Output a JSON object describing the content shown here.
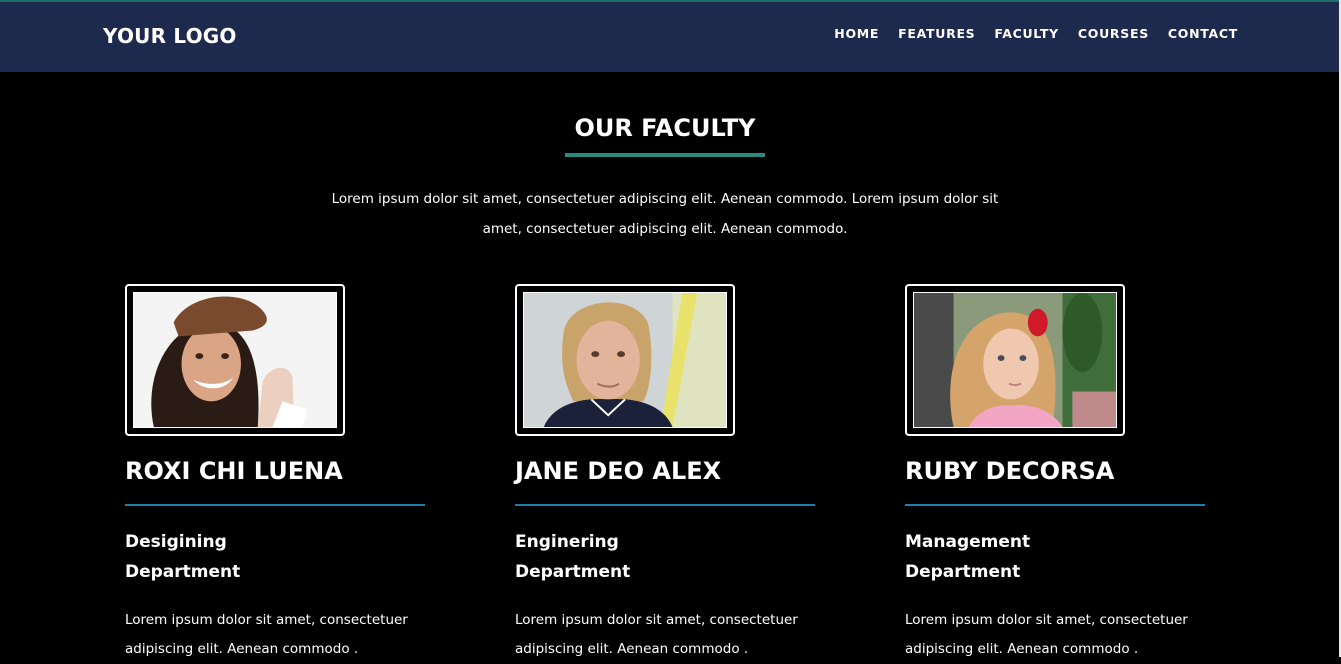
{
  "header": {
    "logo": "YOUR LOGO",
    "nav": [
      {
        "label": "HOME"
      },
      {
        "label": "FEATURES"
      },
      {
        "label": "FACULTY"
      },
      {
        "label": "COURSES"
      },
      {
        "label": "CONTACT"
      }
    ]
  },
  "section": {
    "title": "OUR FACULTY",
    "intro": "Lorem ipsum dolor sit amet, consectetuer adipiscing elit. Aenean commodo. Lorem ipsum dolor sit amet, consectetuer adipiscing elit. Aenean commodo."
  },
  "faculty": [
    {
      "name": "ROXI CHI LUENA",
      "dept_line1": "Desigining",
      "dept_line2": "Department",
      "text": "Lorem ipsum dolor sit amet, consectetuer adipiscing elit. Aenean commodo ."
    },
    {
      "name": "JANE DEO ALEX",
      "dept_line1": "Enginering",
      "dept_line2": "Department",
      "text": "Lorem ipsum dolor sit amet, consectetuer adipiscing elit. Aenean commodo ."
    },
    {
      "name": "RUBY DECORSA",
      "dept_line1": "Management",
      "dept_line2": "Department",
      "text": "Lorem ipsum dolor sit amet, consectetuer adipiscing elit. Aenean commodo ."
    }
  ],
  "colors": {
    "navbar": "#1d2a4e",
    "title_underline": "#2b8a80",
    "name_rule": "#1d7fa8",
    "background": "#000000"
  }
}
